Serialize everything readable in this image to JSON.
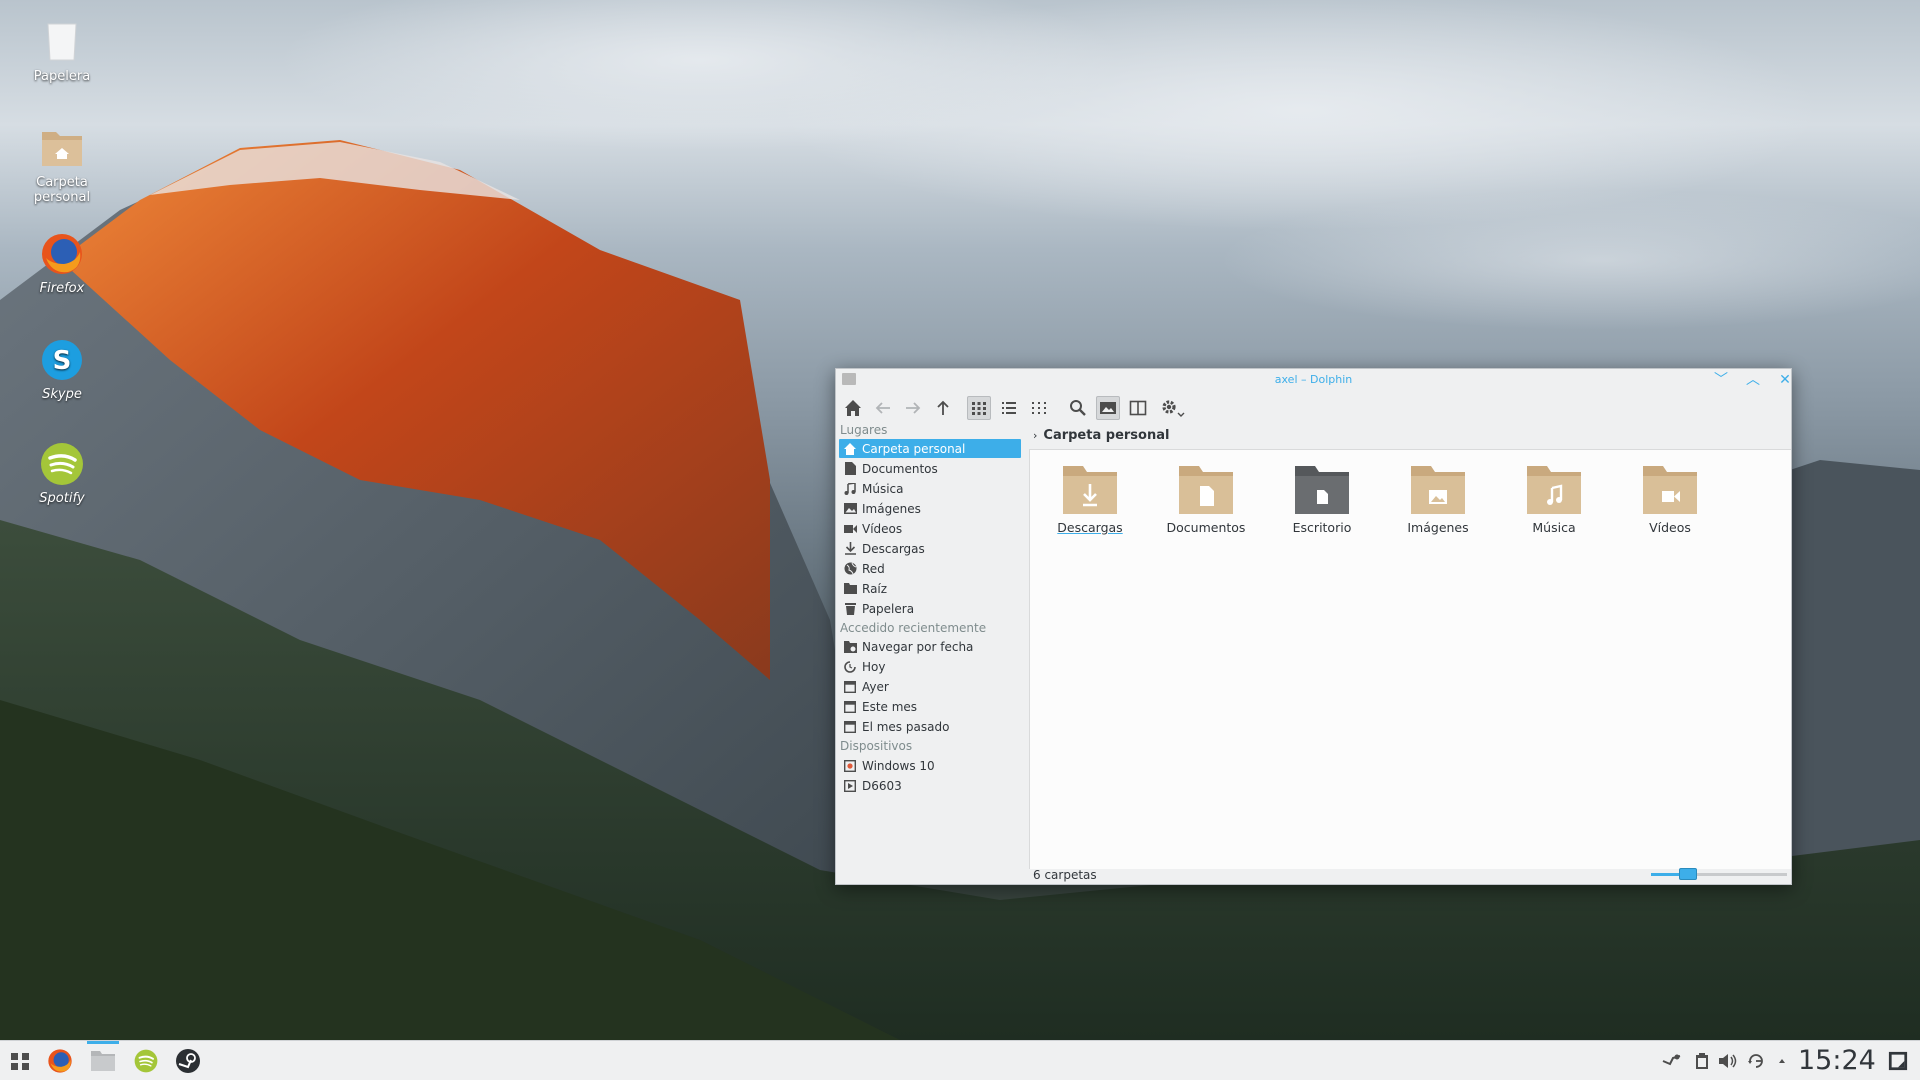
{
  "desktop": {
    "icons": [
      {
        "label": "Papelera",
        "icon": "trash-icon"
      },
      {
        "label": "Carpeta personal",
        "icon": "home-folder-icon"
      },
      {
        "label": "Firefox",
        "icon": "firefox-icon"
      },
      {
        "label": "Skype",
        "icon": "skype-icon"
      },
      {
        "label": "Spotify",
        "icon": "spotify-icon"
      }
    ]
  },
  "window": {
    "title": "axel – Dolphin",
    "controls": {
      "minimize": "﹀",
      "maximize": "︿",
      "close": "✕"
    },
    "toolbar": [
      "home-icon",
      "back-icon",
      "forward-icon",
      "up-icon",
      "icons-view-icon",
      "details-view-icon",
      "compact-view-icon",
      "search-icon",
      "preview-icon",
      "split-icon",
      "settings-icon"
    ],
    "sidebar": {
      "places_title": "Lugares",
      "places": [
        {
          "label": "Carpeta personal",
          "icon": "home-icon",
          "selected": true
        },
        {
          "label": "Documentos",
          "icon": "document-icon"
        },
        {
          "label": "Música",
          "icon": "music-icon"
        },
        {
          "label": "Imágenes",
          "icon": "image-icon"
        },
        {
          "label": "Vídeos",
          "icon": "video-icon"
        },
        {
          "label": "Descargas",
          "icon": "download-icon"
        },
        {
          "label": "Red",
          "icon": "network-icon"
        },
        {
          "label": "Raíz",
          "icon": "folder-icon"
        },
        {
          "label": "Papelera",
          "icon": "trash-icon"
        }
      ],
      "recent_title": "Accedido recientemente",
      "recent": [
        {
          "label": "Navegar por fecha",
          "icon": "folder-date-icon"
        },
        {
          "label": "Hoy",
          "icon": "clock-icon"
        },
        {
          "label": "Ayer",
          "icon": "calendar-icon"
        },
        {
          "label": "Este mes",
          "icon": "calendar-icon"
        },
        {
          "label": "El mes pasado",
          "icon": "calendar-icon"
        }
      ],
      "devices_title": "Dispositivos",
      "devices": [
        {
          "label": "Windows 10",
          "icon": "drive-icon"
        },
        {
          "label": "D6603",
          "icon": "phone-icon"
        }
      ]
    },
    "breadcrumb": "Carpeta personal",
    "folders": [
      {
        "label": "Descargas",
        "icon": "download-icon",
        "dark": false
      },
      {
        "label": "Documentos",
        "icon": "document-icon",
        "dark": false
      },
      {
        "label": "Escritorio",
        "icon": "desktop-icon",
        "dark": true
      },
      {
        "label": "Imágenes",
        "icon": "image-icon",
        "dark": false
      },
      {
        "label": "Música",
        "icon": "music-icon",
        "dark": false
      },
      {
        "label": "Vídeos",
        "icon": "video-icon",
        "dark": false
      }
    ],
    "status": "6 carpetas",
    "zoom_fraction": 0.25
  },
  "panel": {
    "launchers": [
      "app-launcher-icon",
      "firefox-icon",
      "file-manager-icon",
      "spotify-icon",
      "steam-icon"
    ],
    "tray": [
      "steam-tray-icon",
      "clipboard-icon",
      "volume-icon",
      "network-tray-icon",
      "expand-icon"
    ],
    "clock": "15:24"
  },
  "colors": {
    "accent": "#3daee9",
    "folder": "#d2b48c",
    "panel": "#eff0f1"
  }
}
